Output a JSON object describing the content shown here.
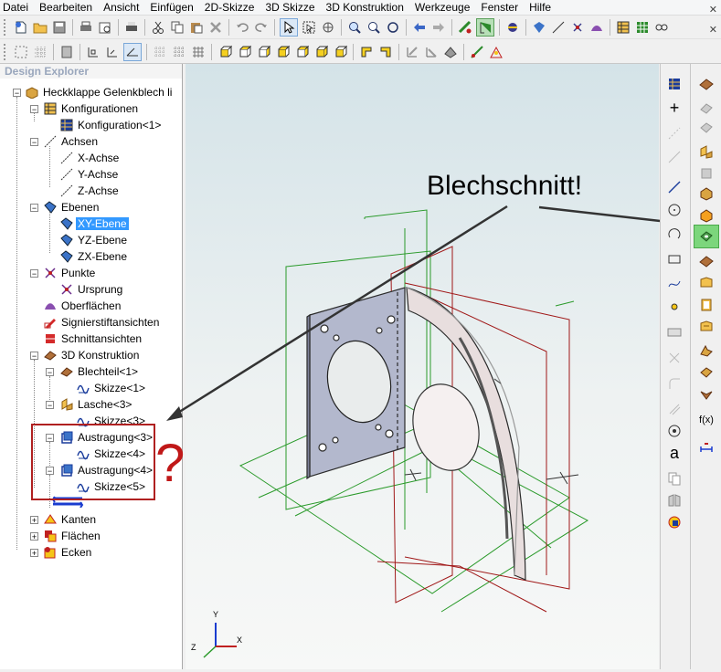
{
  "menu": [
    "Datei",
    "Bearbeiten",
    "Ansicht",
    "Einfügen",
    "2D-Skizze",
    "3D Skizze",
    "3D Konstruktion",
    "Werkzeuge",
    "Fenster",
    "Hilfe"
  ],
  "explorer": {
    "title": "Design Explorer",
    "nodes": [
      "Heckklappe Gelenkblech li",
      "Konfigurationen",
      "Konfiguration<1>",
      "Achsen",
      "X-Achse",
      "Y-Achse",
      "Z-Achse",
      "Ebenen",
      "XY-Ebene",
      "YZ-Ebene",
      "ZX-Ebene",
      "Punkte",
      "Ursprung",
      "Oberflächen",
      "Signierstiftansichten",
      "Schnittansichten",
      "3D Konstruktion",
      "Blechteil<1>",
      "Skizze<1>",
      "Lasche<3>",
      "Skizze<3>",
      "Austragung<3>",
      "Skizze<4>",
      "Austragung<4>",
      "Skizze<5>",
      "Kanten",
      "Flächen",
      "Ecken"
    ],
    "selected": "XY-Ebene"
  },
  "annotations": {
    "callout": "Blechschnitt!",
    "question": "???"
  },
  "right_palette": {
    "fx_label": "f(x)",
    "text_tool_label": "a"
  },
  "colors": {
    "accent_selection": "#3399ff",
    "highlight_tool": "#7cd67c",
    "annotation_red": "#c01818"
  },
  "axes": {
    "y": "Y",
    "z": "Z",
    "x": "X"
  }
}
